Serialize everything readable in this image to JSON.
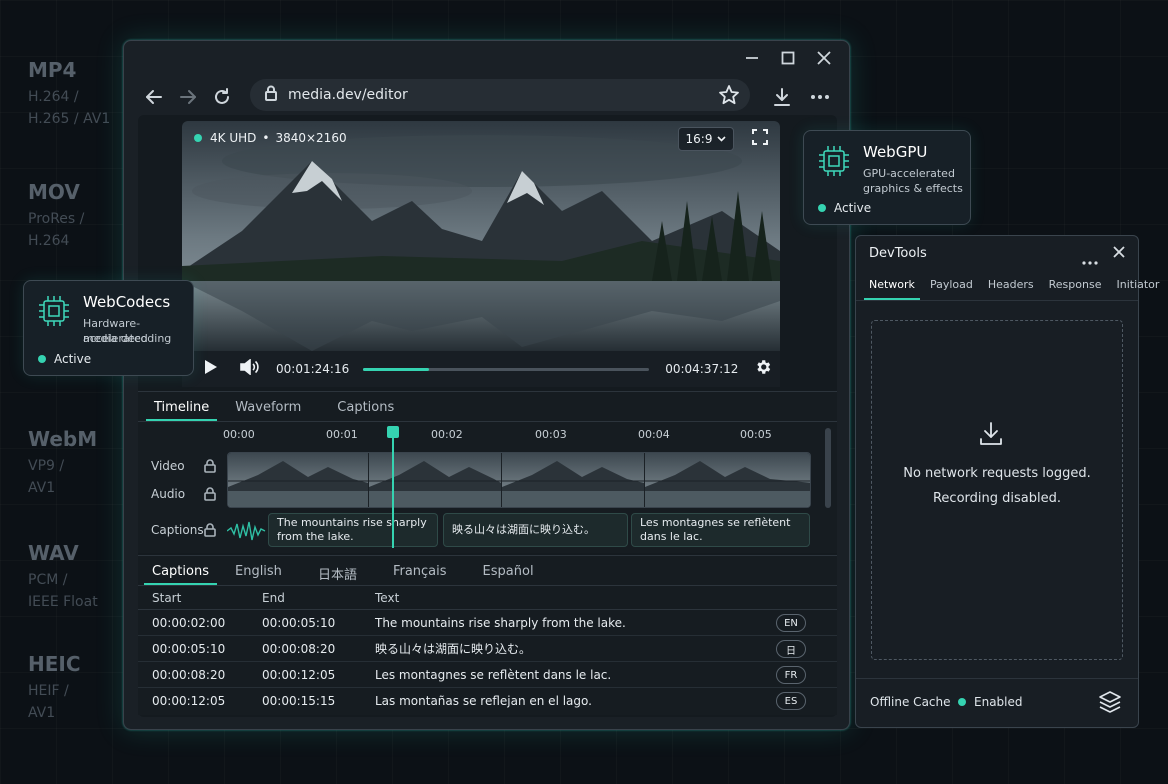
{
  "formats": [
    {
      "name": "MP4",
      "sub1": "H.264 /",
      "sub2": "H.265 / AV1"
    },
    {
      "name": "MOV",
      "sub1": "ProRes /",
      "sub2": "H.264"
    },
    {
      "name": "WebM",
      "sub1": "VP9 /",
      "sub2": "AV1"
    },
    {
      "name": "WAV",
      "sub1": "PCM /",
      "sub2": "IEEE Float"
    },
    {
      "name": "HEIC",
      "sub1": "HEIF /",
      "sub2": "AV1"
    }
  ],
  "browser": {
    "url": "media.dev/editor"
  },
  "video": {
    "quality": "4K UHD",
    "separator": "•",
    "resolution": "3840×2160",
    "aspect_ratio": "16:9",
    "current_time": "00:01:24:16",
    "total_time": "00:04:37:12",
    "progress_percent": 23
  },
  "timeline": {
    "tabs": [
      "Timeline",
      "Waveform",
      "Captions"
    ],
    "ruler": [
      "00:00",
      "00:01",
      "00:02",
      "00:03",
      "00:04",
      "00:05"
    ],
    "tracks": [
      "Video",
      "Audio",
      "Captions"
    ],
    "caption_clips": [
      {
        "line1": "The mountains rise sharply",
        "line2": "from the lake."
      },
      {
        "line1": "映る山々は湖面に映り込む。",
        "line2": ""
      },
      {
        "line1": "Les montagnes se reflètent",
        "line2": "dans le lac."
      }
    ]
  },
  "captions": {
    "tabs": [
      "Captions",
      "English",
      "日本語",
      "Français",
      "Español"
    ],
    "headers": [
      "Start",
      "End",
      "Text"
    ],
    "rows": [
      {
        "start": "00:00:02:00",
        "end": "00:00:05:10",
        "text": "The mountains rise sharply from the lake.",
        "lang": "EN"
      },
      {
        "start": "00:00:05:10",
        "end": "00:00:08:20",
        "text": "映る山々は湖面に映り込む。",
        "lang": "日"
      },
      {
        "start": "00:00:08:20",
        "end": "00:00:12:05",
        "text": "Les montagnes se reflètent dans le lac.",
        "lang": "FR"
      },
      {
        "start": "00:00:12:05",
        "end": "00:00:15:15",
        "text": "Las montañas se reflejan en el lago.",
        "lang": "ES"
      }
    ]
  },
  "webgpu_card": {
    "title": "WebGPU",
    "desc1": "GPU-accelerated",
    "desc2": "graphics & effects",
    "status": "Active"
  },
  "webcodecs_card": {
    "title": "WebCodecs",
    "desc1": "Hardware-accelerated",
    "desc2": "media decoding",
    "status": "Active"
  },
  "devtools": {
    "title": "DevTools",
    "tabs": [
      "Network",
      "Payload",
      "Headers",
      "Response",
      "Initiator"
    ],
    "empty_line1": "No network requests logged.",
    "empty_line2": "Recording disabled.",
    "offline_label": "Offline Cache",
    "offline_status": "Enabled"
  },
  "colors": {
    "accent": "#35d3b1",
    "background": "#0c1116",
    "panel": "#1a2026"
  },
  "icons": [
    "back-arrow-icon",
    "forward-arrow-icon",
    "reload-icon",
    "lock-icon",
    "star-icon",
    "download-icon",
    "more-icon",
    "play-icon",
    "volume-icon",
    "settings-gear-icon",
    "fullscreen-icon",
    "chip-icon",
    "lock-icon",
    "download-tray-icon",
    "layers-icon",
    "close-icon"
  ]
}
